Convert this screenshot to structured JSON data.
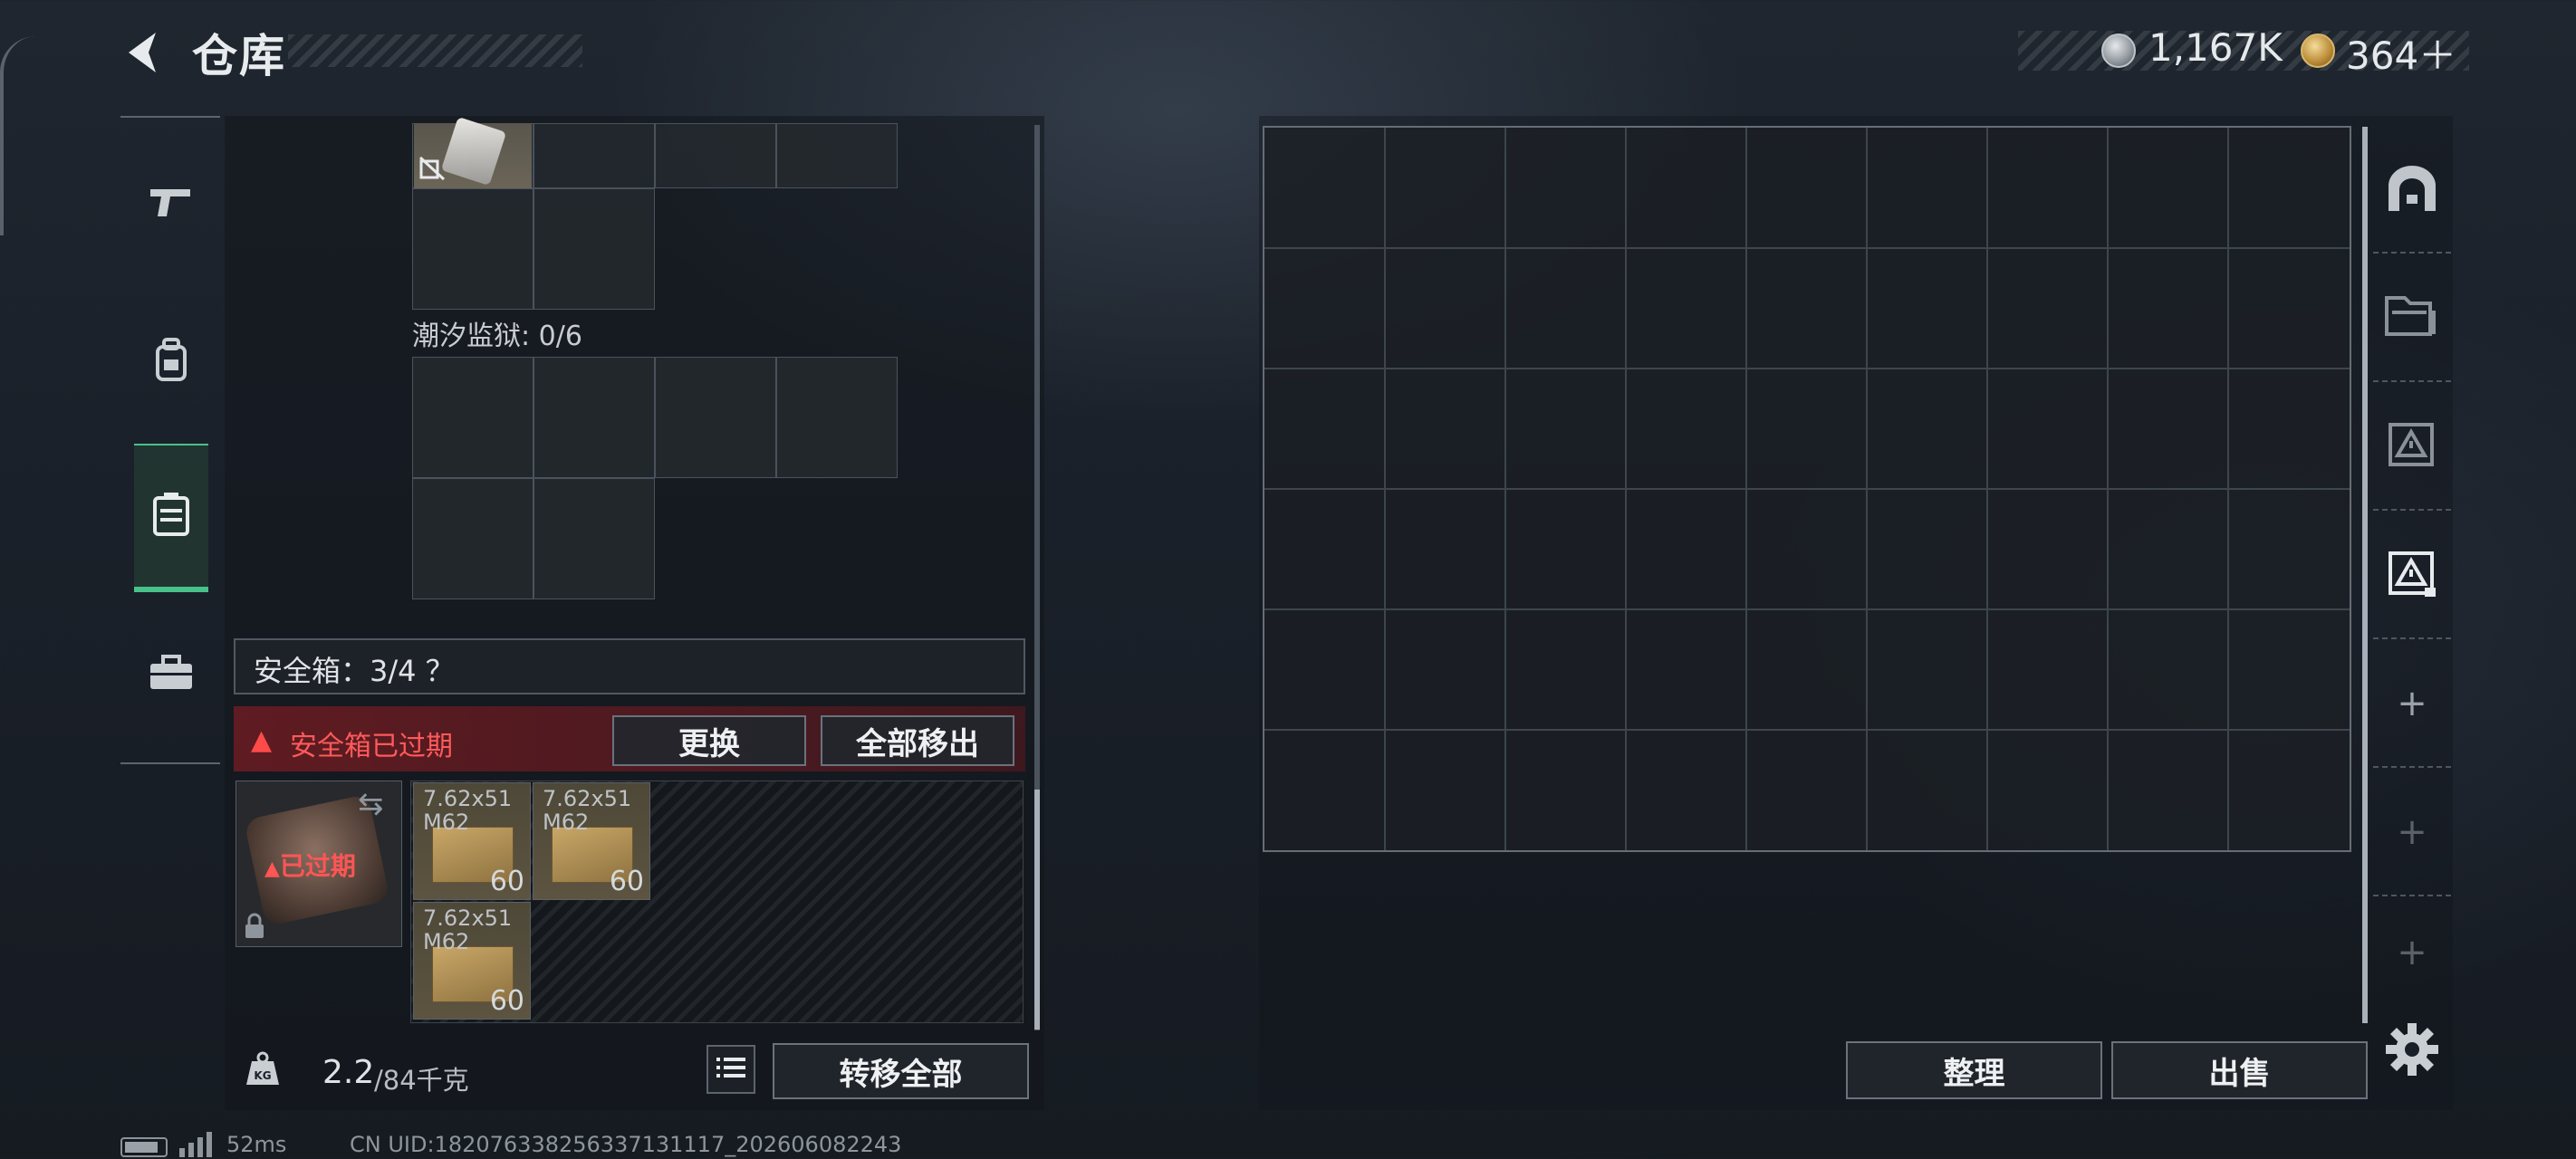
{
  "header": {
    "title": "仓库",
    "currency_silver": "1,167K",
    "currency_gold": "364＋"
  },
  "left_categories": [
    {
      "icon": "pistol-icon",
      "active": false
    },
    {
      "icon": "backpack-icon",
      "active": false
    },
    {
      "icon": "case-icon",
      "active": true
    },
    {
      "icon": "toolbox-icon",
      "active": false
    }
  ],
  "container": {
    "label": "潮汐监狱: 0/6"
  },
  "safe_box": {
    "label": "安全箱：3/4 ？",
    "expired_warning": "安全箱已过期",
    "replace_label": "更换",
    "move_all_label": "全部移出",
    "case_status": "已过期",
    "items": [
      {
        "name": "7.62x51 M62",
        "count": "60"
      },
      {
        "name": "7.62x51 M62",
        "count": "60"
      },
      {
        "name": "7.62x51 M62",
        "count": "60"
      }
    ]
  },
  "footer_left": {
    "weight_icon_text": "KG",
    "weight_value": "2.2",
    "weight_max": "/84千克",
    "transfer_all_label": "转移全部"
  },
  "right_panel": {
    "sort_label": "整理",
    "sell_label": "出售",
    "tabs": [
      "arch-icon",
      "folder-icon",
      "warning-tag-icon",
      "warning-tag-active-icon",
      "plus-icon",
      "plus-icon",
      "plus-icon"
    ],
    "grid": {
      "cols": 9,
      "rows": 6
    }
  },
  "status_bar": {
    "ping": "52ms",
    "uid": "CN UID:182076338256337131117_202606082243"
  },
  "colors": {
    "accent_green": "#48c28a",
    "warning_red": "#ff4a4a"
  }
}
